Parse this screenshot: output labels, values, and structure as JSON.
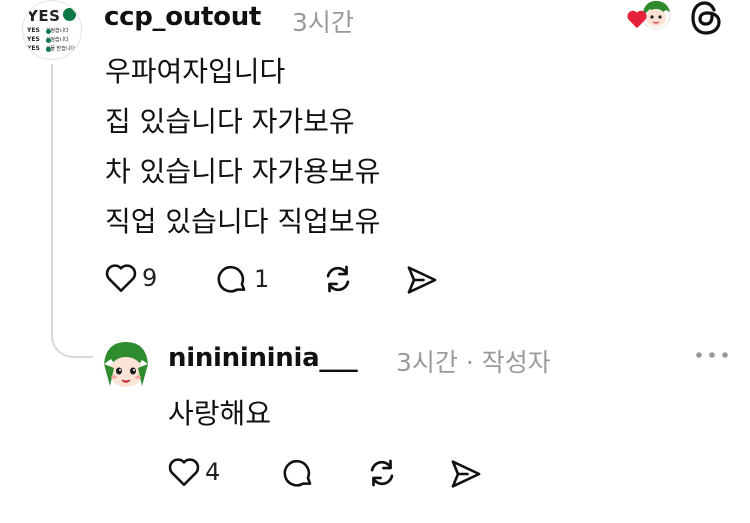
{
  "post": {
    "username": "ccp_outout",
    "timestamp": "3시간",
    "lines": [
      "우파여자입니다",
      "집 있습니다 자가보유",
      "차 있습니다 자가용보유",
      "직업 있습니다 직업보유"
    ],
    "like_count": "9",
    "reply_count": "1",
    "avatar_text": {
      "title": "YES",
      "rows": [
        {
          "label": "YES",
          "text": "가정습니다"
        },
        {
          "label": "YES",
          "text": "사정습니다"
        },
        {
          "label": "YES",
          "text": "선물 받습니다"
        }
      ]
    }
  },
  "reply": {
    "username": "nininininia___",
    "timestamp": "3시간",
    "separator": "·",
    "author_tag": "작성자",
    "text": "사랑해요",
    "like_count": "4"
  },
  "colors": {
    "heart_red": "#e8213a",
    "avatar_green": "#2e8b2e",
    "muted": "#9a9a9a",
    "thread_line": "#d9d9d9"
  },
  "icons": [
    "heart-icon",
    "comment-icon",
    "repost-icon",
    "share-icon",
    "threads-logo-icon",
    "more-icon"
  ]
}
